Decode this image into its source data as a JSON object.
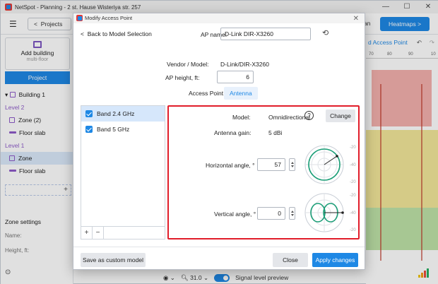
{
  "window": {
    "title": "NetSpot - Planning - 2 st. Hause Wisteriya str. 257",
    "minimize": "—",
    "maximize": "☐",
    "close": "✕"
  },
  "toolbar": {
    "projects_label": "Projects",
    "projects_chevron": "<",
    "plan_label": "lan",
    "heatmaps_label": "Heatmaps",
    "heatmaps_chevron": ">"
  },
  "sidebar": {
    "add_building": "Add building",
    "add_building_sub": "multi-floor",
    "project_tab": "Project",
    "tree": [
      {
        "label": "Building 1",
        "type": "building"
      },
      {
        "label": "Level 2",
        "type": "level"
      },
      {
        "label": "Zone (2)",
        "type": "zone"
      },
      {
        "label": "Floor slab",
        "type": "slab"
      },
      {
        "label": "Level 1",
        "type": "level"
      },
      {
        "label": "Zone",
        "type": "zone-selected"
      },
      {
        "label": "Floor slab",
        "type": "slab"
      }
    ],
    "add_row_symbol": "+",
    "zone_settings": "Zone settings",
    "name_label": "Name:",
    "height_label": "Height, ft:"
  },
  "map": {
    "toolbar_label": "d Access Point",
    "undo": "↶",
    "redo": "↷",
    "ruler_ticks": [
      "70",
      "80",
      "90",
      "10"
    ]
  },
  "status": {
    "zoom": "31.0",
    "signal_preview": "Signal level preview"
  },
  "colors": {
    "accent": "#1e88e5",
    "highlight_border": "#e11d2a",
    "polar_green": "#1b9e77"
  },
  "dialog": {
    "title": "Modify Access Point",
    "close": "✕",
    "back_label": "Back to Model Selection",
    "ap_name_label": "AP name:",
    "ap_name_value": "D-Link DIR-X3260",
    "vendor_model_label": "Vendor / Model:",
    "vendor_model_value": "D-Link/DIR-X3260",
    "ap_height_label": "AP height, ft:",
    "ap_height_value": "6",
    "tab_access_point": "Access Point",
    "tab_antenna": "Antenna",
    "bands": [
      {
        "label": "Band 2.4 GHz",
        "checked": true,
        "selected": true
      },
      {
        "label": "Band 5 GHz",
        "checked": true,
        "selected": false
      }
    ],
    "band_add": "+",
    "band_remove": "−",
    "antenna": {
      "model_label": "Model:",
      "model_value": "Omnidirectional",
      "help": "?",
      "change_label": "Change",
      "gain_label": "Antenna gain:",
      "gain_value": "5 dBi",
      "horizontal_label": "Horizontal angle, °",
      "horizontal_value": "57",
      "vertical_label": "Vertical angle, °",
      "vertical_value": "0",
      "scale_labels": [
        "-20",
        "-40",
        "-20"
      ]
    },
    "save_custom_label": "Save as custom model",
    "close_label": "Close",
    "apply_label": "Apply changes"
  }
}
